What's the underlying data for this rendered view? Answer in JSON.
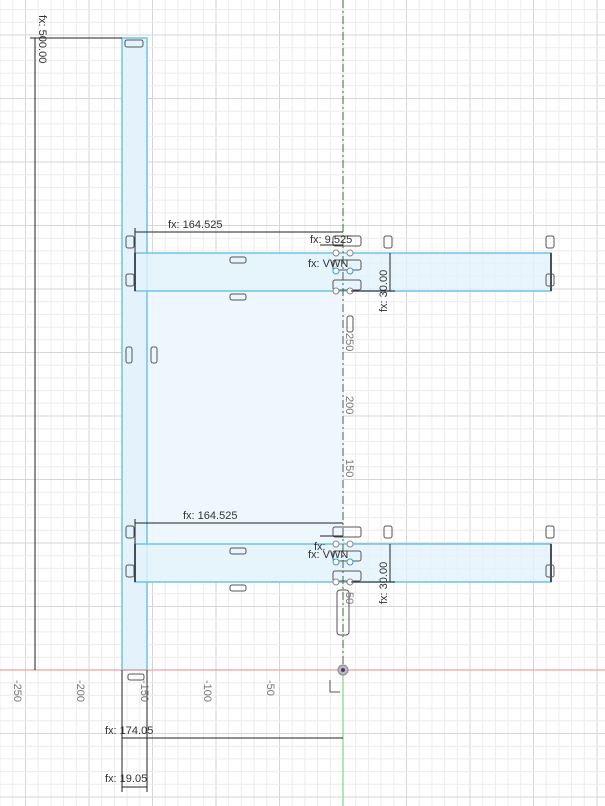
{
  "colors": {
    "grid_minor": "#ececec",
    "grid_major": "#d6d6d6",
    "body_fill": "#e6f4fc",
    "body_stroke": "#6fc3e8",
    "x_axis": "#f0a0a0",
    "y_axis": "#7fd67f",
    "dim": "#222222"
  },
  "dimensions": {
    "height_total": "fx: 500.00",
    "top_offset": "fx: 164.525",
    "bottom_offset": "fx: 164.525",
    "top_bar_height": "fx: 30.00",
    "bottom_bar_height": "fx: 30.00",
    "overall_width": "fx: 174.05",
    "post_width": "fx: 19.05",
    "small_top": "fx: 9.525",
    "small_top_2": "fx: VWN",
    "small_bottom": "fx:",
    "small_bottom_2": "fx: VWN"
  },
  "x_ticks": [
    "-250",
    "-200",
    "-150",
    "-100",
    "-50"
  ],
  "y_ticks": [
    "250",
    "200",
    "150",
    "50"
  ]
}
